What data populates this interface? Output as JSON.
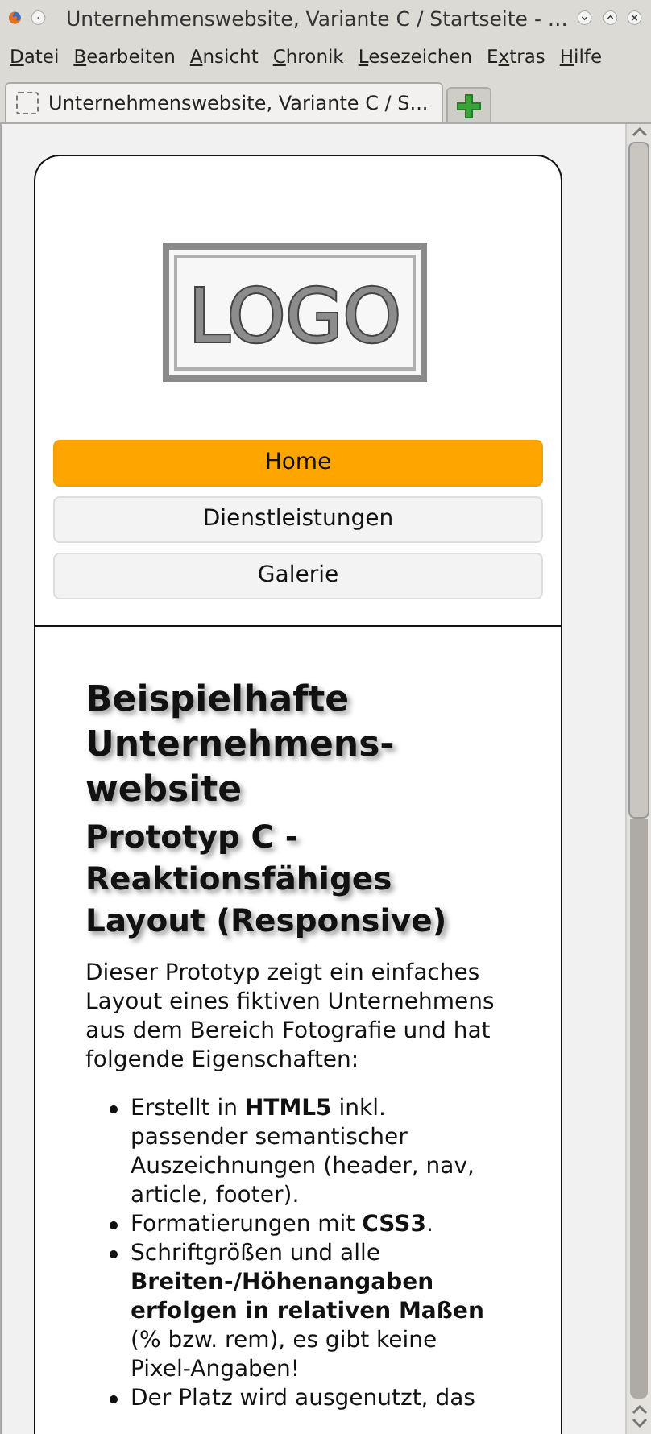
{
  "window": {
    "title": "Unternehmenswebsite, Variante C / Startseite - …"
  },
  "menu": [
    {
      "key": "D",
      "after": "atei"
    },
    {
      "key": "B",
      "after": "earbeiten"
    },
    {
      "key": "A",
      "after": "nsicht"
    },
    {
      "key": "C",
      "after": "hronik"
    },
    {
      "key": "L",
      "after": "esezeichen"
    },
    {
      "before": "E",
      "key": "x",
      "after": "tras"
    },
    {
      "key": "H",
      "after": "ilfe"
    }
  ],
  "tabs": [
    {
      "label": "Unternehmenswebsite, Variante C / S...",
      "selected": true
    }
  ],
  "page": {
    "logo": {
      "text": "LOGO"
    },
    "nav": [
      {
        "label": "Home",
        "selected": true
      },
      {
        "label": "Dienstleistungen",
        "selected": false
      },
      {
        "label": "Galerie",
        "selected": false
      }
    ],
    "heading": "Beispielhafte Unternehmens-website",
    "subheading": "Prototyp C - Reaktionsfähiges Layout (Responsive)",
    "intro": "Dieser Prototyp zeigt ein einfaches Layout eines fiktiven Unternehmens aus dem Bereich Fotografie und hat folgende Eigenschaften:",
    "features": [
      "Erstellt in **HTML5** inkl. passender semantischer Auszeichnungen (header, nav, article, footer).",
      "Formatierungen mit **CSS3**.",
      "Schriftgrößen und alle **Breiten-/Höhenangaben erfolgen in relativen Maßen** (% bzw. rem), es gibt keine Pixel-Angaben!",
      "Der Platz wird ausgenutzt, das"
    ]
  }
}
